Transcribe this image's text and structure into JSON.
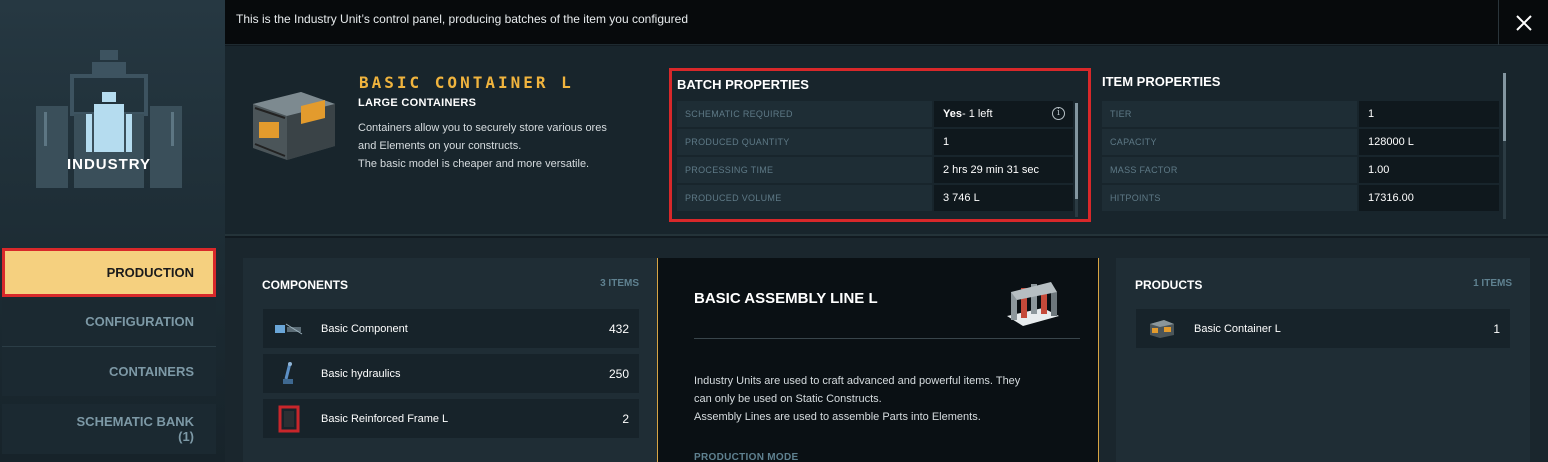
{
  "header": {
    "description": "This is the Industry Unit’s control panel, producing batches of the item you configured"
  },
  "sidebar": {
    "logo_label": "INDUSTRY",
    "items": [
      {
        "label": "PRODUCTION",
        "active": true
      },
      {
        "label": "CONFIGURATION",
        "active": false
      },
      {
        "label": "CONTAINERS",
        "active": false
      },
      {
        "label": "SCHEMATIC BANK",
        "sub": "(1)",
        "active": false
      }
    ]
  },
  "item": {
    "title": "BASIC CONTAINER L",
    "category": "LARGE CONTAINERS",
    "description_lines": [
      "Containers allow you to securely store various ores",
      "and Elements on your constructs.",
      "The basic model is cheaper and more versatile."
    ],
    "icon": "container-icon"
  },
  "batch_properties": {
    "title": "BATCH PROPERTIES",
    "rows": [
      {
        "key": "SCHEMATIC REQUIRED",
        "value_bold": "Yes",
        "value": " - 1 left",
        "icon": "info-icon"
      },
      {
        "key": "PRODUCED QUANTITY",
        "value_bold": "",
        "value": "1"
      },
      {
        "key": "PROCESSING TIME",
        "value_bold": "",
        "value": "2 hrs 29 min 31 sec"
      },
      {
        "key": "PRODUCED VOLUME",
        "value_bold": "",
        "value": "3 746 L"
      }
    ]
  },
  "item_properties": {
    "title": "ITEM PROPERTIES",
    "rows": [
      {
        "key": "TIER",
        "value": "1"
      },
      {
        "key": "CAPACITY",
        "value": "128000 L"
      },
      {
        "key": "MASS FACTOR",
        "value": "1.00"
      },
      {
        "key": "HITPOINTS",
        "value": "17316.00"
      }
    ]
  },
  "components": {
    "title": "COMPONENTS",
    "count": "3 ITEMS",
    "items": [
      {
        "name": "Basic Component",
        "qty": "432",
        "icon": "component-icon"
      },
      {
        "name": "Basic hydraulics",
        "qty": "250",
        "icon": "hydraulics-icon"
      },
      {
        "name": "Basic Reinforced Frame L",
        "qty": "2",
        "icon": "frame-icon"
      }
    ]
  },
  "assembly": {
    "title": "BASIC ASSEMBLY LINE L",
    "description_lines": [
      "Industry Units are used to craft advanced and powerful items. They",
      "can only be used on Static Constructs.",
      "Assembly Lines are used to assemble Parts into Elements."
    ],
    "mode_label": "PRODUCTION MODE",
    "icon": "assembly-line-icon"
  },
  "products": {
    "title": "PRODUCTS",
    "count": "1 ITEMS",
    "items": [
      {
        "name": "Basic Container L",
        "qty": "1",
        "icon": "container-icon"
      }
    ]
  },
  "colors": {
    "accent": "#f0b43e",
    "active_tab": "#f5d07f",
    "highlight_border": "#d8282a"
  }
}
